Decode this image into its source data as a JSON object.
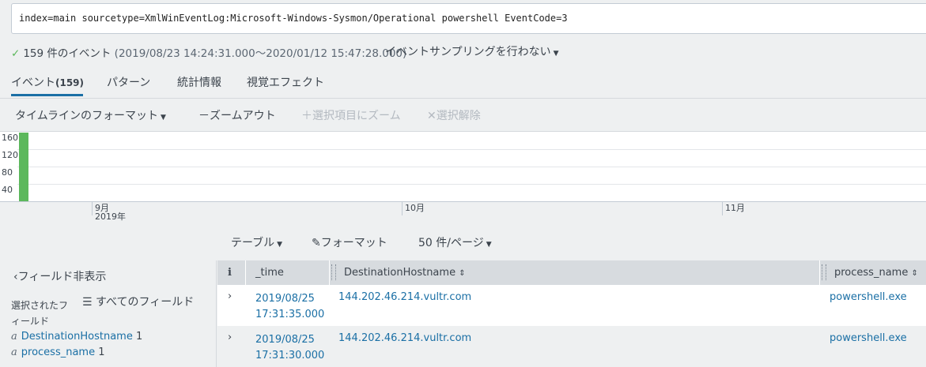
{
  "search": {
    "query": "index=main sourcetype=XmlWinEventLog:Microsoft-Windows-Sysmon/Operational powershell EventCode=3"
  },
  "summary": {
    "check_icon": "✓",
    "count": "159 件のイベント",
    "range": "(2019/08/23 14:24:31.000～2020/01/12 15:47:28.000)",
    "sampling": "イベントサンプリングを行わない"
  },
  "tabs": [
    {
      "label": "イベント",
      "count": "(159)"
    },
    {
      "label": "パターン"
    },
    {
      "label": "統計情報"
    },
    {
      "label": "視覚エフェクト"
    }
  ],
  "timeline_tools": {
    "format": "タイムラインのフォーマット",
    "zoom_out": "－ズームアウト",
    "zoom_selection": "＋選択項目にズーム",
    "deselect": "✕選択解除"
  },
  "chart_data": {
    "type": "bar",
    "y_ticks": [
      "160",
      "120",
      "80",
      "40"
    ],
    "x_labels": [
      {
        "month": "9月",
        "year": "2019年"
      },
      {
        "month": "10月",
        "year": ""
      },
      {
        "month": "11月",
        "year": ""
      }
    ],
    "bar_color": "#5cb85c",
    "values": [
      {
        "date": "2019/08/25",
        "count": 159
      }
    ]
  },
  "results_tools": {
    "table": "テーブル",
    "format": "フォーマット",
    "per_page": "50 件/ページ"
  },
  "fields": {
    "hide": "フィールド非表示",
    "selected_line1": "選択されたフ",
    "selected_line2": "ィールド",
    "all_fields": "すべてのフィールド",
    "items": [
      {
        "type": "a",
        "name": "DestinationHostname",
        "count": "1"
      },
      {
        "type": "a",
        "name": "process_name",
        "count": "1"
      }
    ]
  },
  "table": {
    "columns": {
      "info": "i",
      "time": "_time",
      "dest": "DestinationHostname",
      "proc": "process_name"
    },
    "rows": [
      {
        "date": "2019/08/25",
        "time": "17:31:35.000",
        "dest": "144.202.46.214.vultr.com",
        "proc": "powershell.exe"
      },
      {
        "date": "2019/08/25",
        "time": "17:31:30.000",
        "dest": "144.202.46.214.vultr.com",
        "proc": "powershell.exe"
      }
    ]
  }
}
